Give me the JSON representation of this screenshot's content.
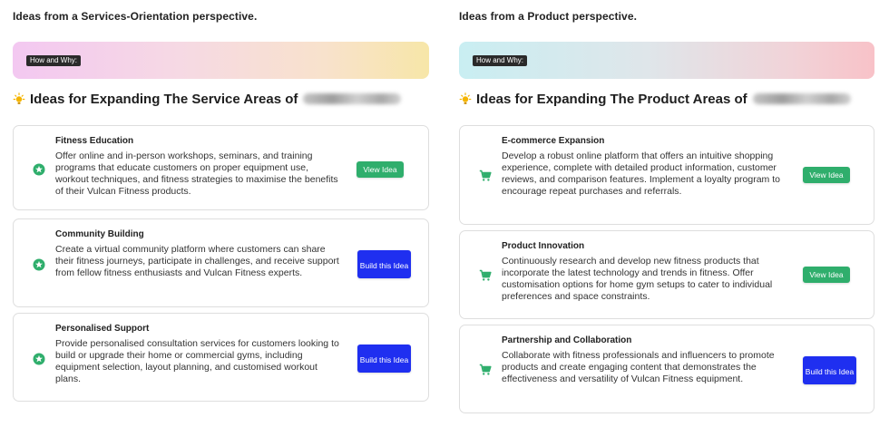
{
  "left": {
    "section_title": "Ideas from a Services-Orientation perspective.",
    "pill": "How and Why:",
    "heading": "Ideas for Expanding The Service Areas of",
    "cards": [
      {
        "title": "Fitness Education",
        "description": "Offer online and in-person workshops, seminars, and training programs that educate customers on proper equipment use, workout techniques, and fitness strategies to maximise the benefits of their Vulcan Fitness products.",
        "button": "View Idea",
        "icon": "star-circle-icon"
      },
      {
        "title": "Community Building",
        "description": "Create a virtual community platform where customers can share their fitness journeys, participate in challenges, and receive support from fellow fitness enthusiasts and Vulcan Fitness experts.",
        "button": "Build this Idea",
        "icon": "star-circle-icon"
      },
      {
        "title": "Personalised Support",
        "description": "Provide personalised consultation services for customers looking to build or upgrade their home or commercial gyms, including equipment selection, layout planning, and customised workout plans.",
        "button": "Build this Idea",
        "icon": "star-circle-icon"
      }
    ]
  },
  "right": {
    "section_title": "Ideas from a Product perspective.",
    "pill": "How and Why:",
    "heading": "Ideas for Expanding The Product Areas of",
    "cards": [
      {
        "title": "E-commerce Expansion",
        "description": "Develop a robust online platform that offers an intuitive shopping experience, complete with detailed product information, customer reviews, and comparison features. Implement a loyalty program to encourage repeat purchases and referrals.",
        "button": "View Idea",
        "icon": "cart-icon"
      },
      {
        "title": "Product Innovation",
        "description": "Continuously research and develop new fitness products that incorporate the latest technology and trends in fitness. Offer customisation options for home gym setups to cater to individual preferences and space constraints.",
        "button": "View Idea",
        "icon": "cart-icon"
      },
      {
        "title": "Partnership and Collaboration",
        "description": "Collaborate with fitness professionals and influencers to promote products and create engaging content that demonstrates the effectiveness and versatility of Vulcan Fitness equipment.",
        "button": "Build this Idea",
        "icon": "cart-icon"
      }
    ]
  },
  "colors": {
    "view_button": "#2fae6c",
    "build_button": "#1f2ff0",
    "icon_green": "#2fae6c"
  }
}
